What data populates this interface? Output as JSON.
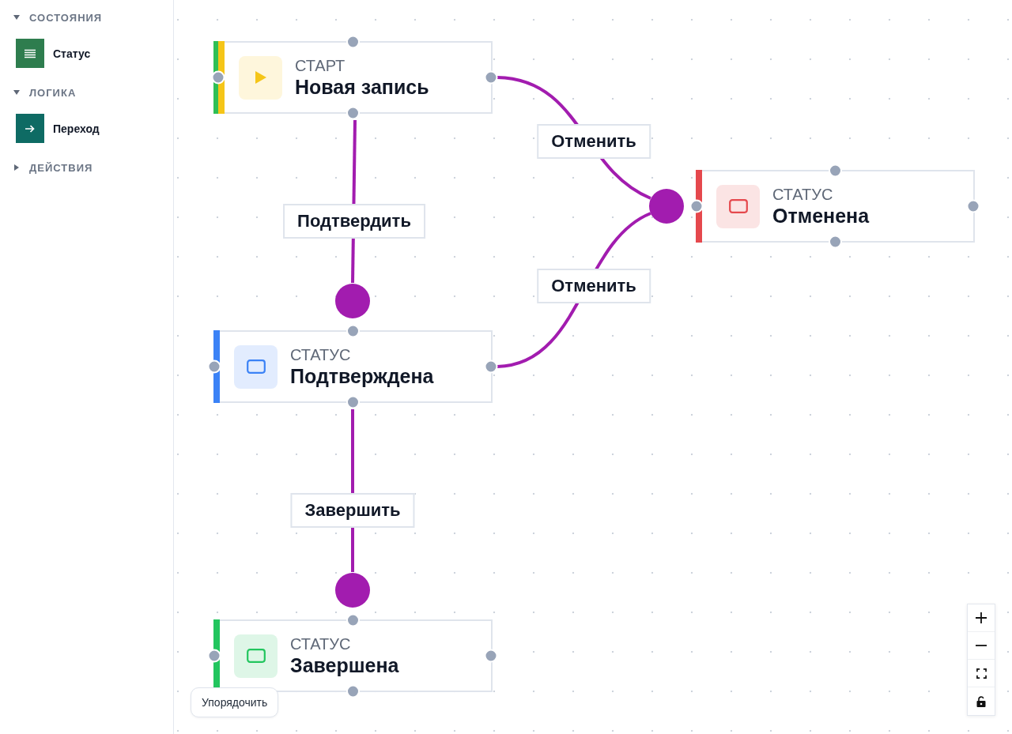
{
  "sidebar": {
    "sections": [
      {
        "title": "СОСТОЯНИЯ",
        "expanded": true,
        "items": [
          {
            "label": "Статус",
            "kind": "status",
            "color": "#2e7d4e"
          }
        ]
      },
      {
        "title": "ЛОГИКА",
        "expanded": true,
        "items": [
          {
            "label": "Переход",
            "kind": "transition",
            "color": "#0e6b64"
          }
        ]
      },
      {
        "title": "ДЕЙСТВИЯ",
        "expanded": false
      }
    ]
  },
  "canvas": {
    "nodes": [
      {
        "kind": "start",
        "type_label": "СТАРТ",
        "title": "Новая запись",
        "color": "#f5c518"
      },
      {
        "kind": "status",
        "type_label": "СТАТУС",
        "title": "Отменена",
        "color": "#e5484d"
      },
      {
        "kind": "status",
        "type_label": "СТАТУС",
        "title": "Подтверждена",
        "color": "#3b82f6"
      },
      {
        "kind": "status",
        "type_label": "СТАТУС",
        "title": "Завершена",
        "color": "#22c55e"
      }
    ],
    "edges": [
      {
        "label": "Отменить"
      },
      {
        "label": "Подтвердить"
      },
      {
        "label": "Отменить"
      },
      {
        "label": "Завершить"
      }
    ],
    "arrange_button": "Упорядочить",
    "controls": {
      "locked": false
    }
  }
}
